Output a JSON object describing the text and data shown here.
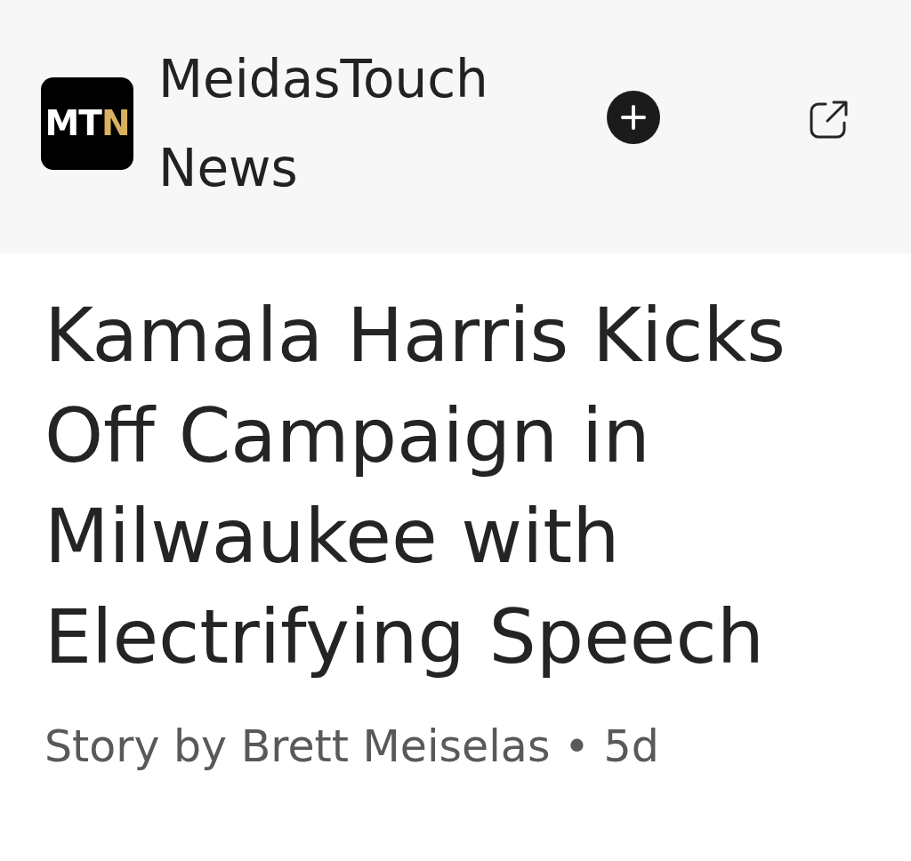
{
  "publisher": {
    "logo": {
      "parts": [
        {
          "text": "MT",
          "color": "#ffffff"
        },
        {
          "text": "N",
          "color": "#d9b15f"
        }
      ]
    },
    "name": "MeidasTouch News"
  },
  "article": {
    "title": "Kamala Harris Kicks Off Campaign in Milwaukee with Electrifying Speech",
    "byline": "Story by Brett Meiselas • 5d"
  }
}
